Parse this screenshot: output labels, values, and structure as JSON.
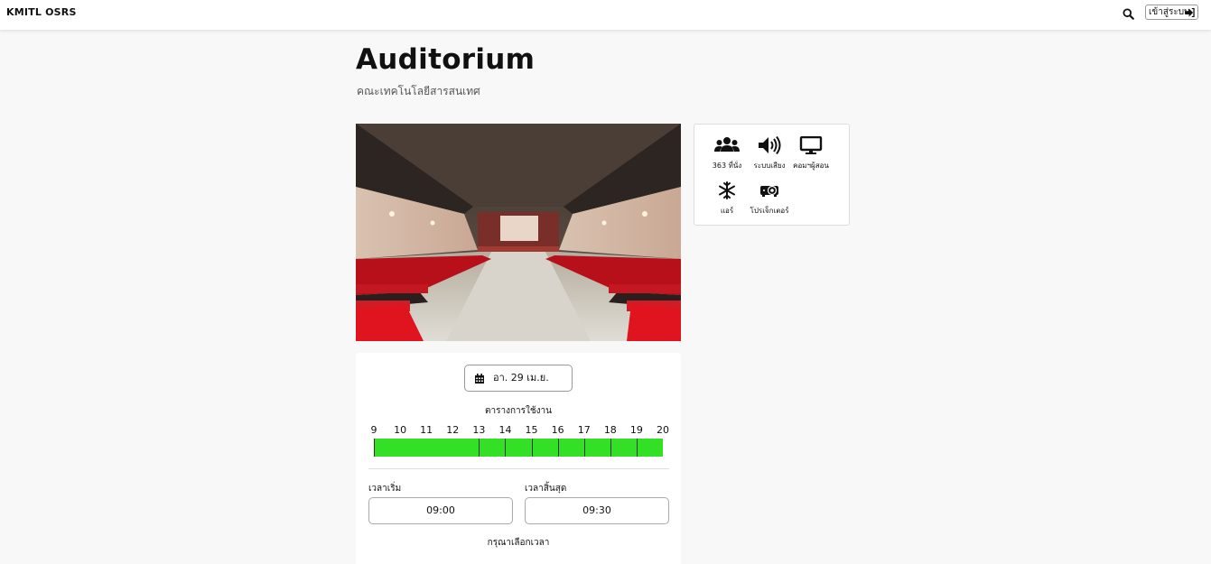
{
  "navbar": {
    "brand": "KMITL OSRS",
    "search_icon": "search-icon",
    "login_label": "เข้าสู่ระบบ",
    "login_icon": "sign-in-icon"
  },
  "room": {
    "title": "Auditorium",
    "faculty": "คณะเทคโนโลยีสารสนเทศ"
  },
  "amenities": [
    {
      "icon": "users-icon",
      "label": "363 ที่นั่ง"
    },
    {
      "icon": "volume-icon",
      "label": "ระบบเสียง"
    },
    {
      "icon": "monitor-icon",
      "label": "คอมฯผู้สอน"
    },
    {
      "icon": "snowflake-icon",
      "label": "แอร์"
    },
    {
      "icon": "projector-icon",
      "label": "โปรเจ็กเตอร์"
    }
  ],
  "booking": {
    "date_label": "อา. 29 เม.ย.",
    "schedule_label": "ตารางการใช้งาน",
    "hours": [
      "9",
      "10",
      "11",
      "12",
      "13",
      "14",
      "15",
      "16",
      "17",
      "18",
      "19",
      "20"
    ],
    "available_color": "#33e026",
    "start_label": "เวลาเริ่ม",
    "start_value": "09:00",
    "end_label": "เวลาสิ้นสุด",
    "end_value": "09:30",
    "hint": "กรุณาเลือกเวลา"
  }
}
